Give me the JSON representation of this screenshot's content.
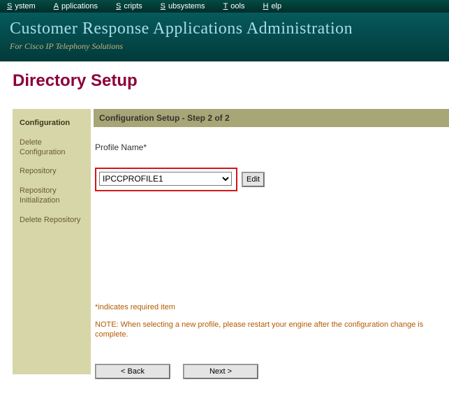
{
  "menubar": {
    "items": [
      {
        "letter": "S",
        "rest": "ystem"
      },
      {
        "letter": "A",
        "rest": "pplications"
      },
      {
        "letter": "S",
        "rest": "cripts"
      },
      {
        "letter": "S",
        "rest": "ubsystems"
      },
      {
        "letter": "T",
        "rest": "ools"
      },
      {
        "letter": "H",
        "rest": "elp"
      }
    ]
  },
  "banner": {
    "title": "Customer Response Applications Administration",
    "subtitle": "For Cisco IP Telephony Solutions"
  },
  "page": {
    "title": "Directory Setup"
  },
  "sidebar": {
    "items": [
      {
        "label": "Configuration",
        "active": true
      },
      {
        "label": "Delete Configuration",
        "active": false
      },
      {
        "label": "Repository",
        "active": false
      },
      {
        "label": "Repository Initialization",
        "active": false
      },
      {
        "label": "Delete Repository",
        "active": false
      }
    ]
  },
  "section": {
    "heading": "Configuration Setup - Step 2 of 2"
  },
  "form": {
    "profile_label": "Profile Name*",
    "profile_value": "IPCCPROFILE1",
    "edit_label": "Edit",
    "required_note": "*indicates required item",
    "restart_note": "NOTE: When selecting a new profile, please restart your engine after the configuration change is complete.",
    "back_label": "< Back",
    "next_label": "Next >"
  }
}
